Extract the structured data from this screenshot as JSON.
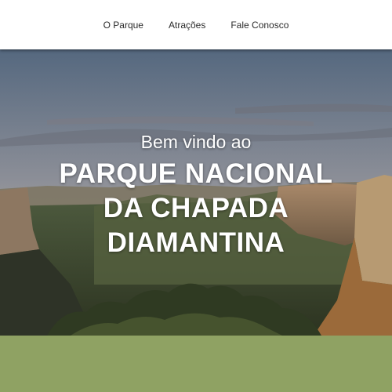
{
  "nav": {
    "items": [
      {
        "label": "O Parque"
      },
      {
        "label": "Atrações"
      },
      {
        "label": "Fale Conosco"
      }
    ]
  },
  "hero": {
    "welcome": "Bem vindo ao",
    "title_lines": [
      "PARQUE NACIONAL",
      "DA CHAPADA",
      "DIAMANTINA"
    ]
  },
  "colors": {
    "nav_bg": "#ffffff",
    "band": "#8fa263",
    "sky_top": "#5a6f86",
    "sky_bottom": "#c9c2b3"
  }
}
